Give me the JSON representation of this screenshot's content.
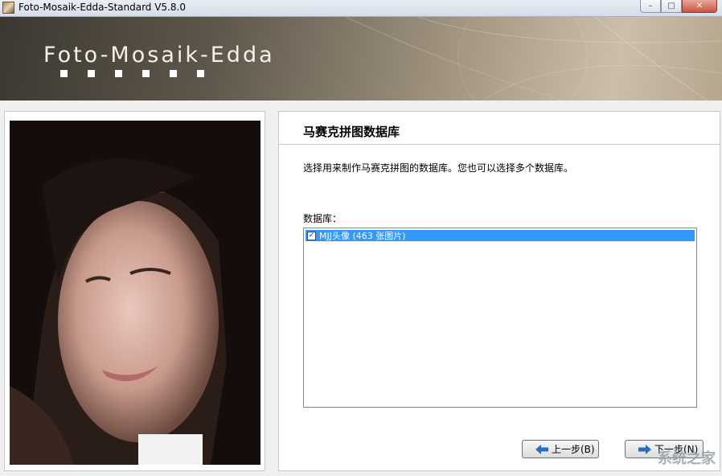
{
  "window": {
    "title": "Foto-Mosaik-Edda-Standard V5.8.0",
    "controls": {
      "minimize": "–",
      "maximize": "□",
      "close": "✕"
    }
  },
  "banner": {
    "logo_text": "Foto-Mosaik-Edda"
  },
  "wizard": {
    "title": "马赛克拼图数据库",
    "description": "选择用来制作马赛克拼图的数据库。您也可以选择多个数据库。",
    "database_label": "数据库：",
    "databases": [
      {
        "name": "MJJ头像 (463 张图片)",
        "checked": true,
        "check_mark": "✓"
      }
    ]
  },
  "buttons": {
    "back_label": "上一步(B)",
    "next_label": "下一步(N)"
  },
  "watermark": "系统之家",
  "colors": {
    "selection": "#3399ff",
    "arrow": "#2b6cc4"
  }
}
